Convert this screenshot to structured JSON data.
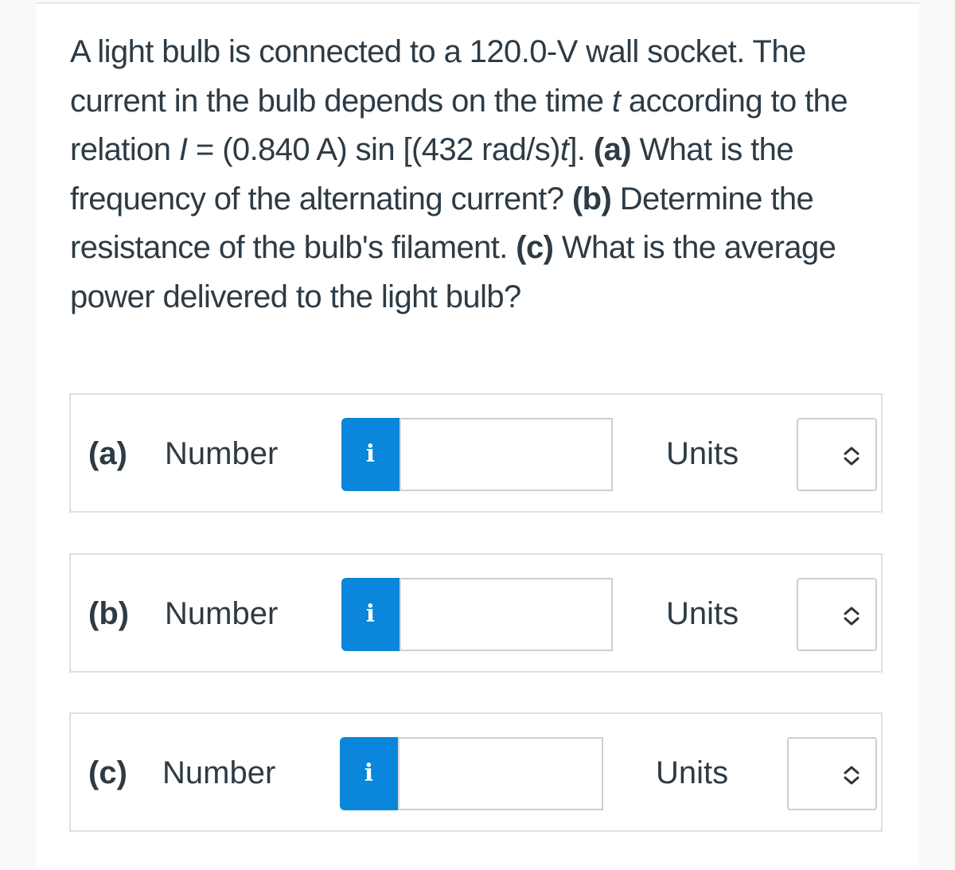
{
  "question": {
    "segments": [
      {
        "text": "A light bulb is connected to a 120.0-V wall socket. The current in the bulb depends on the time ",
        "style": "normal"
      },
      {
        "text": "t",
        "style": "italic"
      },
      {
        "text": " according to the relation ",
        "style": "normal"
      },
      {
        "text": "I",
        "style": "italic"
      },
      {
        "text": " = (0.840 A) sin [(432 rad/s)",
        "style": "normal"
      },
      {
        "text": "t",
        "style": "italic"
      },
      {
        "text": "]. ",
        "style": "normal"
      },
      {
        "text": "(a)",
        "style": "bold"
      },
      {
        "text": " What is the frequency of the alternating current? ",
        "style": "normal"
      },
      {
        "text": "(b)",
        "style": "bold"
      },
      {
        "text": " Determine the resistance of the bulb's filament. ",
        "style": "normal"
      },
      {
        "text": "(c)",
        "style": "bold"
      },
      {
        "text": " What is the average power delivered to the light bulb?",
        "style": "normal"
      }
    ]
  },
  "answers": [
    {
      "part": "(a)",
      "number_label": "Number",
      "info_icon": "i",
      "value": "",
      "units_label": "Units",
      "units_selected": ""
    },
    {
      "part": "(b)",
      "number_label": "Number",
      "info_icon": "i",
      "value": "",
      "units_label": "Units",
      "units_selected": ""
    },
    {
      "part": "(c)",
      "number_label": "Number",
      "info_icon": "i",
      "value": "",
      "units_label": "Units",
      "units_selected": ""
    }
  ],
  "colors": {
    "accent": "#0a86da",
    "text": "#2d3b45",
    "border": "#e0e0e0"
  }
}
